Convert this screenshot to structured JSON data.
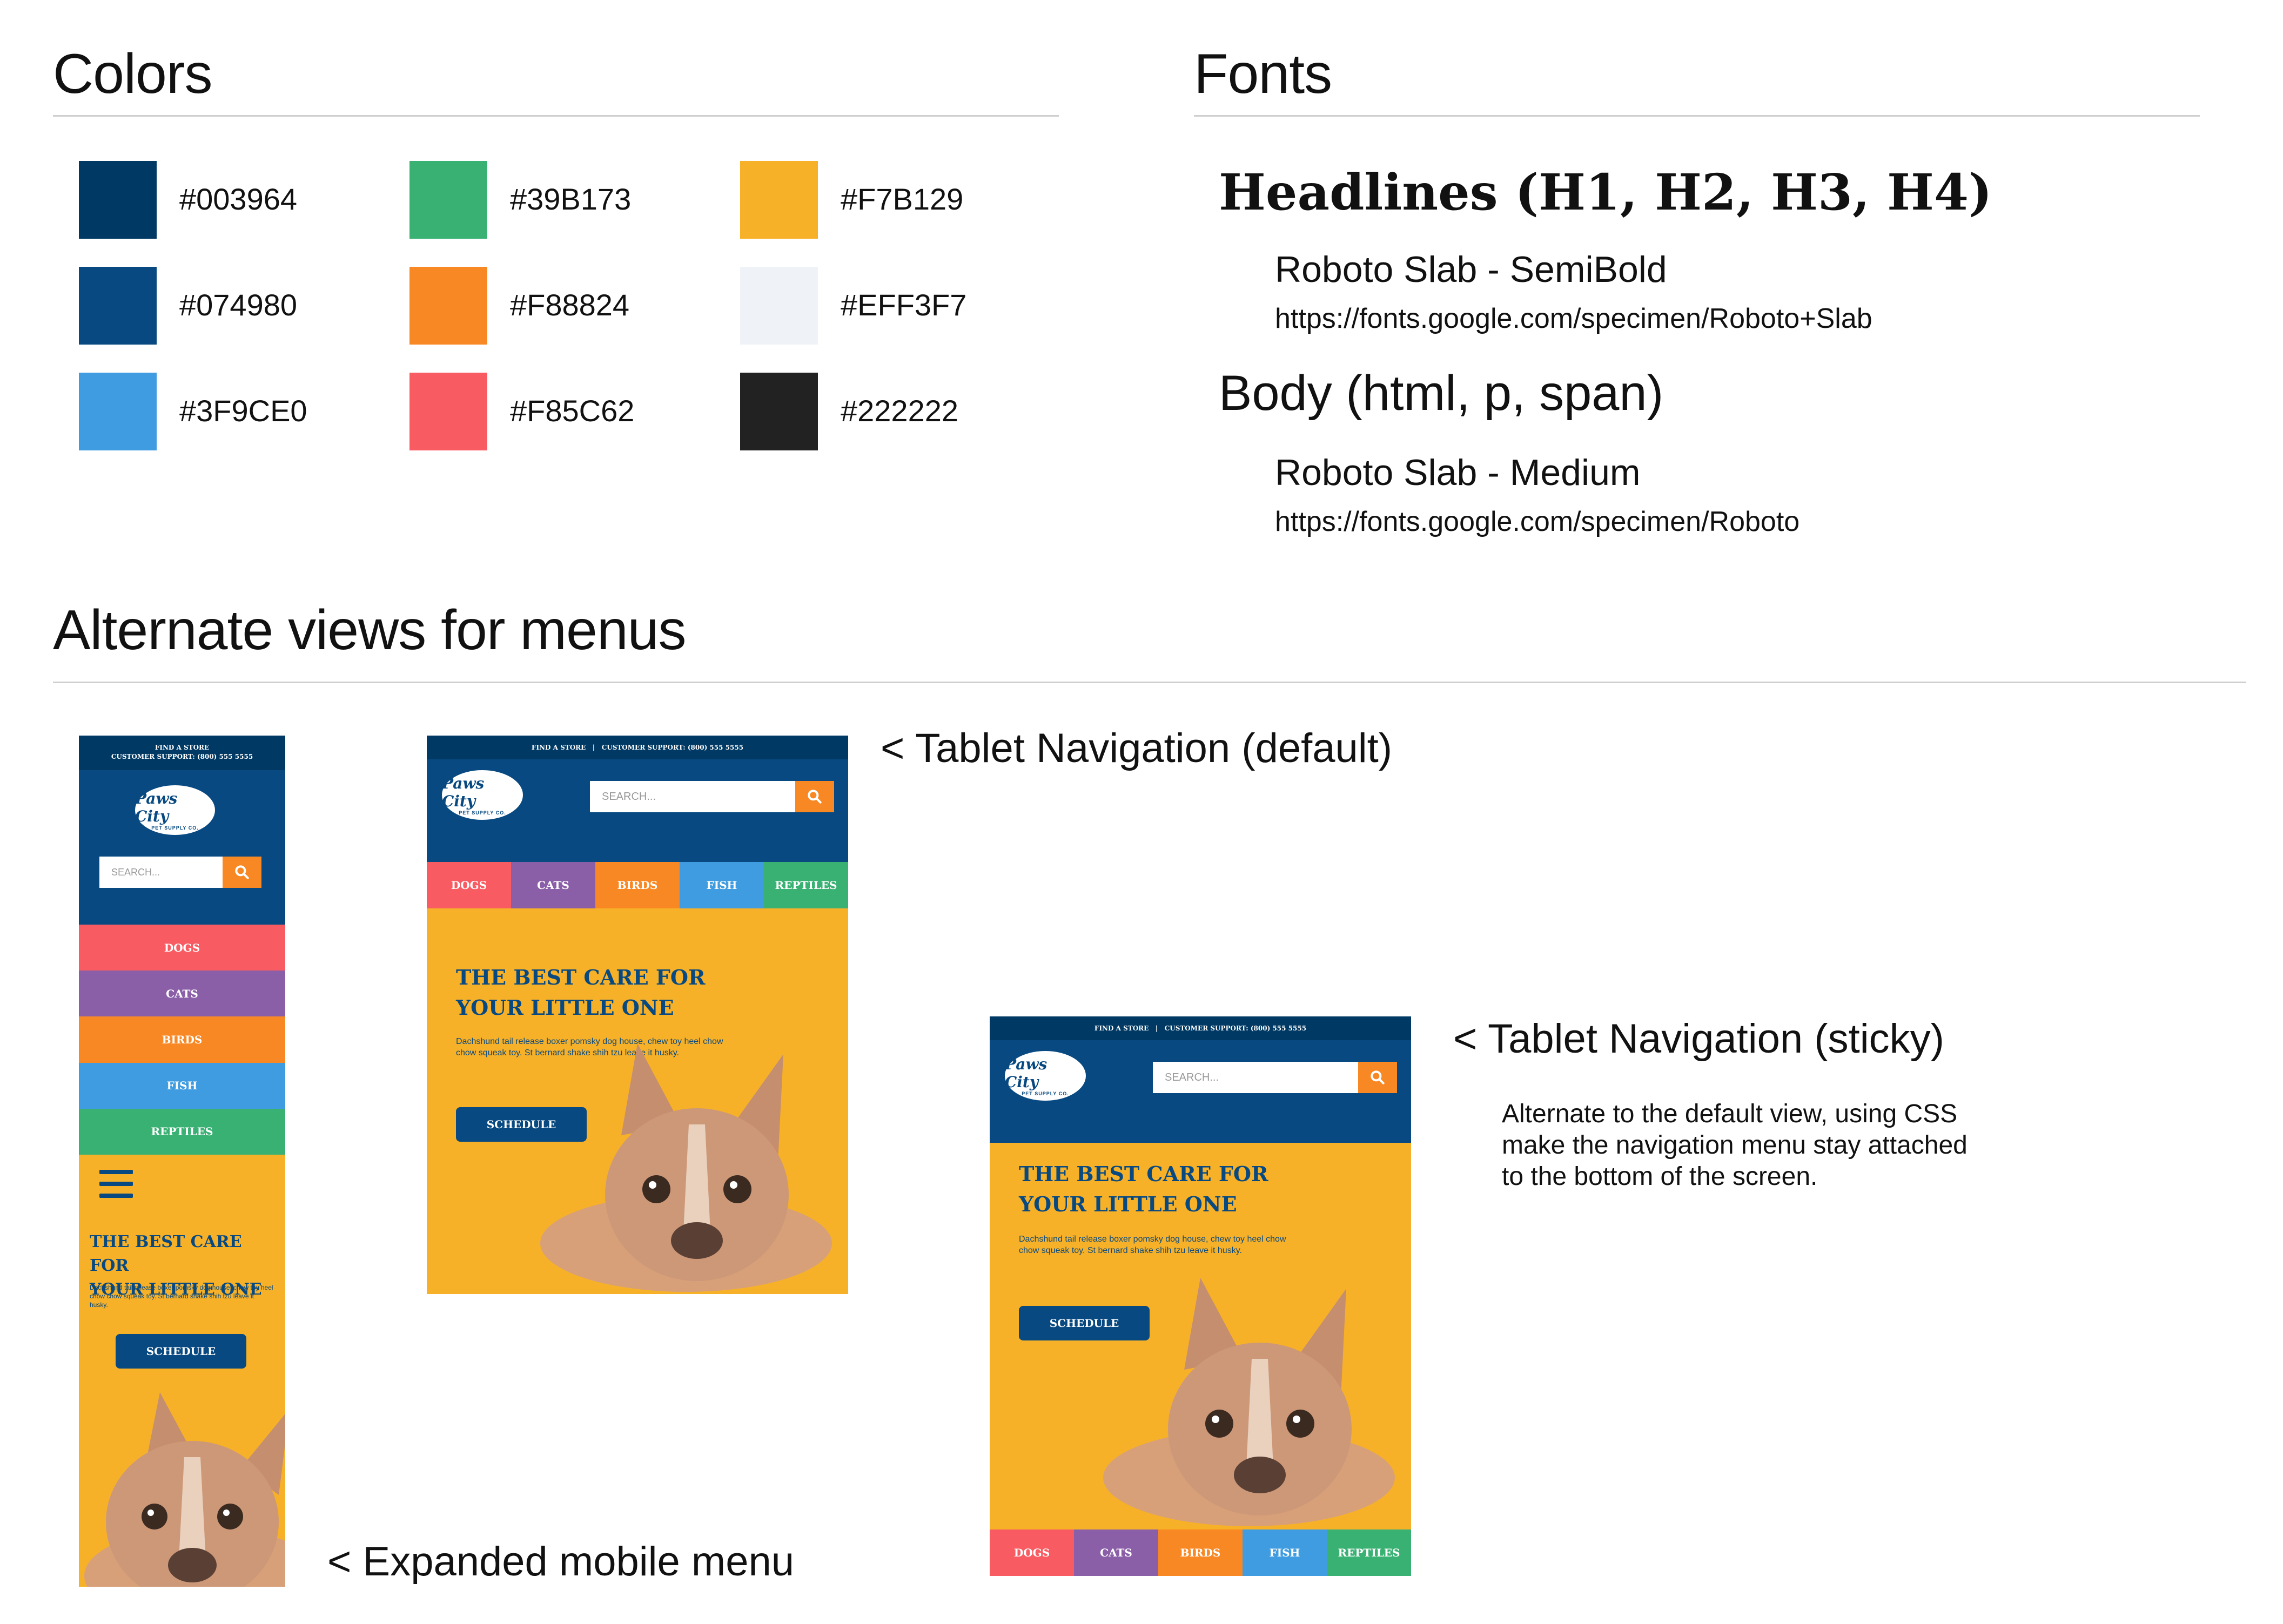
{
  "colors_section": {
    "title": "Colors",
    "swatches": [
      {
        "hex": "#003964"
      },
      {
        "hex": "#074980"
      },
      {
        "hex": "#3F9CE0"
      },
      {
        "hex": "#39B173"
      },
      {
        "hex": "#F88824"
      },
      {
        "hex": "#F85C62"
      },
      {
        "hex": "#F7B129"
      },
      {
        "hex": "#EFF3F7"
      },
      {
        "hex": "#222222"
      }
    ]
  },
  "fonts_section": {
    "title": "Fonts",
    "headline_label": "Headlines (H1, H2, H3, H4)",
    "headline_font": "Roboto Slab - SemiBold",
    "headline_url": "https://fonts.google.com/specimen/Roboto+Slab",
    "body_label": "Body (html, p, span)",
    "body_font": "Roboto Slab - Medium",
    "body_url": "https://fonts.google.com/specimen/Roboto"
  },
  "menus_section": {
    "title": "Alternate views for menus",
    "caption_tablet_default": "< Tablet Navigation (default)",
    "caption_tablet_sticky": "< Tablet Navigation (sticky)",
    "caption_mobile": "< Expanded mobile menu",
    "sticky_note": "Alternate to the default view, using CSS make the navigation menu stay attached to the bottom of the screen."
  },
  "mockup": {
    "topbar_store": "FIND A STORE",
    "topbar_support": "CUSTOMER SUPPORT: (800) 555 5555",
    "topbar_full": "FIND A STORE   |   CUSTOMER SUPPORT: (800) 555 5555",
    "logo_text": "Paws City",
    "logo_tag": "PET SUPPLY CO.",
    "search_placeholder": "SEARCH...",
    "nav": [
      {
        "label": "DOGS",
        "color": "#F85C62"
      },
      {
        "label": "CATS",
        "color": "#8B5FA8"
      },
      {
        "label": "BIRDS",
        "color": "#F88824"
      },
      {
        "label": "FISH",
        "color": "#3F9CE0"
      },
      {
        "label": "REPTILES",
        "color": "#39B173"
      }
    ],
    "hero_title_1": "THE BEST CARE FOR",
    "hero_title_2": "YOUR LITTLE ONE",
    "hero_body": "Dachshund tail release boxer pomsky dog house, chew toy heel chow chow squeak toy. St bernard shake shih tzu leave it husky.",
    "button_label": "SCHEDULE"
  }
}
